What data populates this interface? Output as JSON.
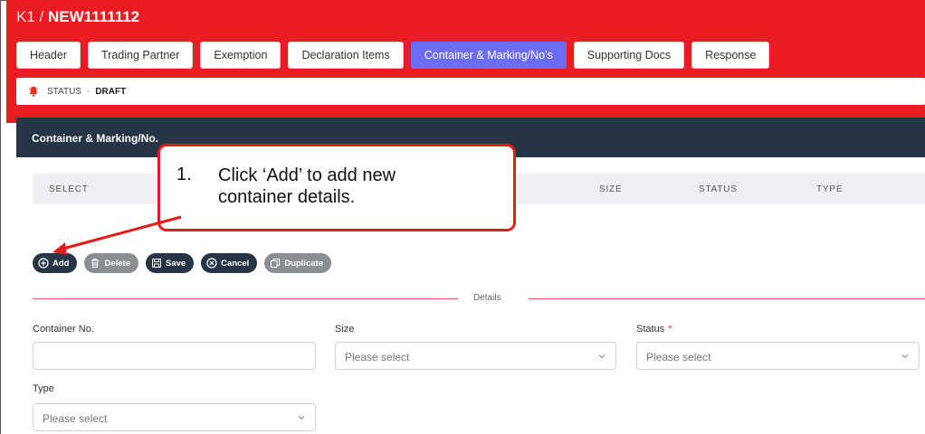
{
  "header": {
    "crumb": "K1 /",
    "declaration_no": "NEW1111112"
  },
  "tabs": [
    {
      "label": "Header"
    },
    {
      "label": "Trading Partner"
    },
    {
      "label": "Exemption"
    },
    {
      "label": "Declaration Items"
    },
    {
      "label": "Container & Marking/No's",
      "active": true
    },
    {
      "label": "Supporting Docs"
    },
    {
      "label": "Response"
    }
  ],
  "status": {
    "label": "STATUS",
    "separator": "-",
    "value": "DRAFT"
  },
  "card": {
    "title": "Container & Marking/No."
  },
  "table": {
    "columns": [
      "SELECT",
      "SIZE",
      "STATUS",
      "TYPE"
    ]
  },
  "actions": {
    "add": "Add",
    "delete": "Delete",
    "save": "Save",
    "cancel": "Cancel",
    "duplicate": "Duplicate"
  },
  "details": {
    "section_label": "Details",
    "container_no_label": "Container No.",
    "container_no_value": "",
    "size_label": "Size",
    "size_value": "Please select",
    "status_label": "Status",
    "status_required": "*",
    "status_value": "Please select",
    "type_label": "Type",
    "type_value": "Please select"
  },
  "callout": {
    "number": "1.",
    "line1": "Click ‘Add’ to add new",
    "line2": "container details."
  },
  "colors": {
    "brand_red": "#ea1c23",
    "active_tab": "#6c6cf4",
    "dark_navy": "#263646",
    "callout_red": "#e41c1c"
  }
}
